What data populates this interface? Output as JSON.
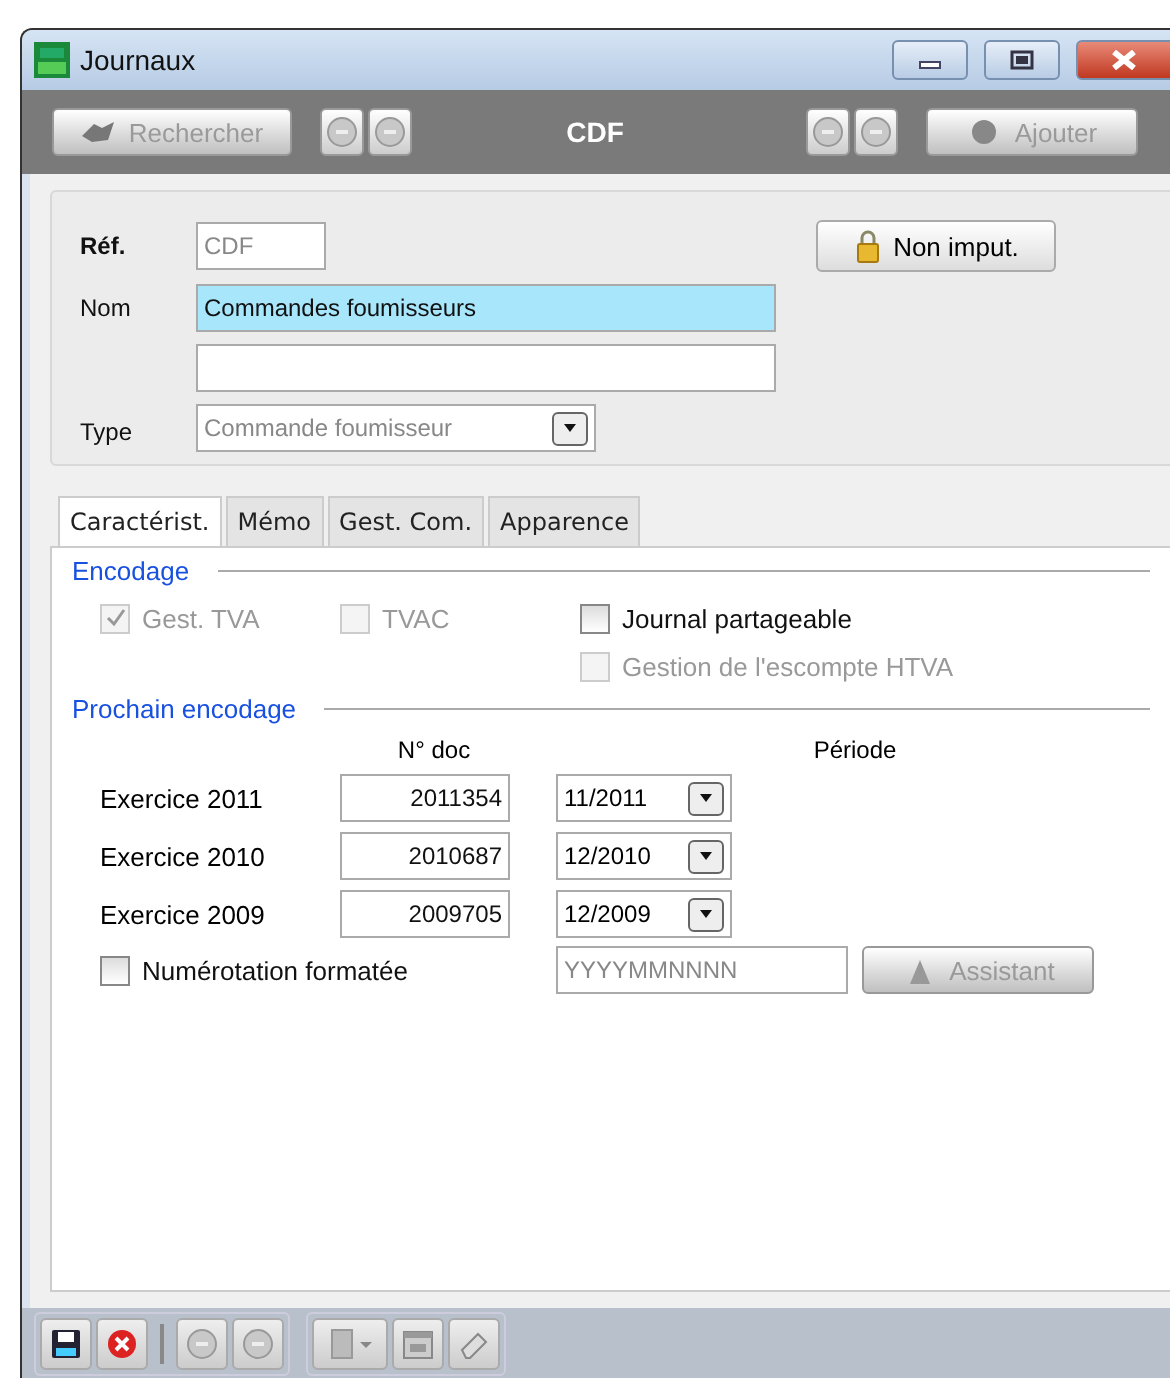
{
  "window": {
    "title": "Journaux"
  },
  "toolbar": {
    "search_button": {
      "label": "Rechercher",
      "disabled": true
    },
    "current": "CDF",
    "add_button": {
      "label": "Ajouter",
      "disabled": true
    }
  },
  "header": {
    "ref": {
      "label": "Réf.",
      "value": "CDF",
      "disabled": true
    },
    "name": {
      "label": "Nom",
      "value": "Commandes foumisseurs",
      "focused": true
    },
    "type": {
      "label": "Type",
      "value": "Commande foumisseur"
    },
    "lock_button": {
      "label": "Non imput."
    }
  },
  "tabs": [
    {
      "label": "Caractérist.",
      "selected": true
    },
    {
      "label": "Mémo",
      "selected": false
    },
    {
      "label": "Gest. Com.",
      "selected": false
    },
    {
      "label": "Apparence",
      "selected": false
    }
  ],
  "encodage": {
    "title": "Encodage",
    "checkboxes": [
      {
        "label": "Gest. TVA",
        "checked": true,
        "disabled": true
      },
      {
        "label": "TVAC",
        "checked": false,
        "disabled": true
      },
      {
        "label": "Journal partageable",
        "checked": false,
        "disabled": false
      },
      {
        "label": "Gestion de l'escompte HTVA",
        "checked": false,
        "disabled": true
      }
    ]
  },
  "prochain": {
    "title": "Prochain encodage",
    "columns": [
      "N° doc",
      "Période"
    ],
    "rows": [
      {
        "label": "Exercice 2011",
        "doc": "2011354",
        "period": "11/2011"
      },
      {
        "label": "Exercice 2010",
        "doc": "2010687",
        "period": "12/2010"
      },
      {
        "label": "Exercice 2009",
        "doc": "2009705",
        "period": "12/2009"
      }
    ],
    "format": {
      "label": "Numérotation formatée",
      "checked": false,
      "value": "YYYYMMNNNN",
      "disabled": true
    },
    "assistant": {
      "label": "Assistant",
      "disabled": true
    }
  }
}
